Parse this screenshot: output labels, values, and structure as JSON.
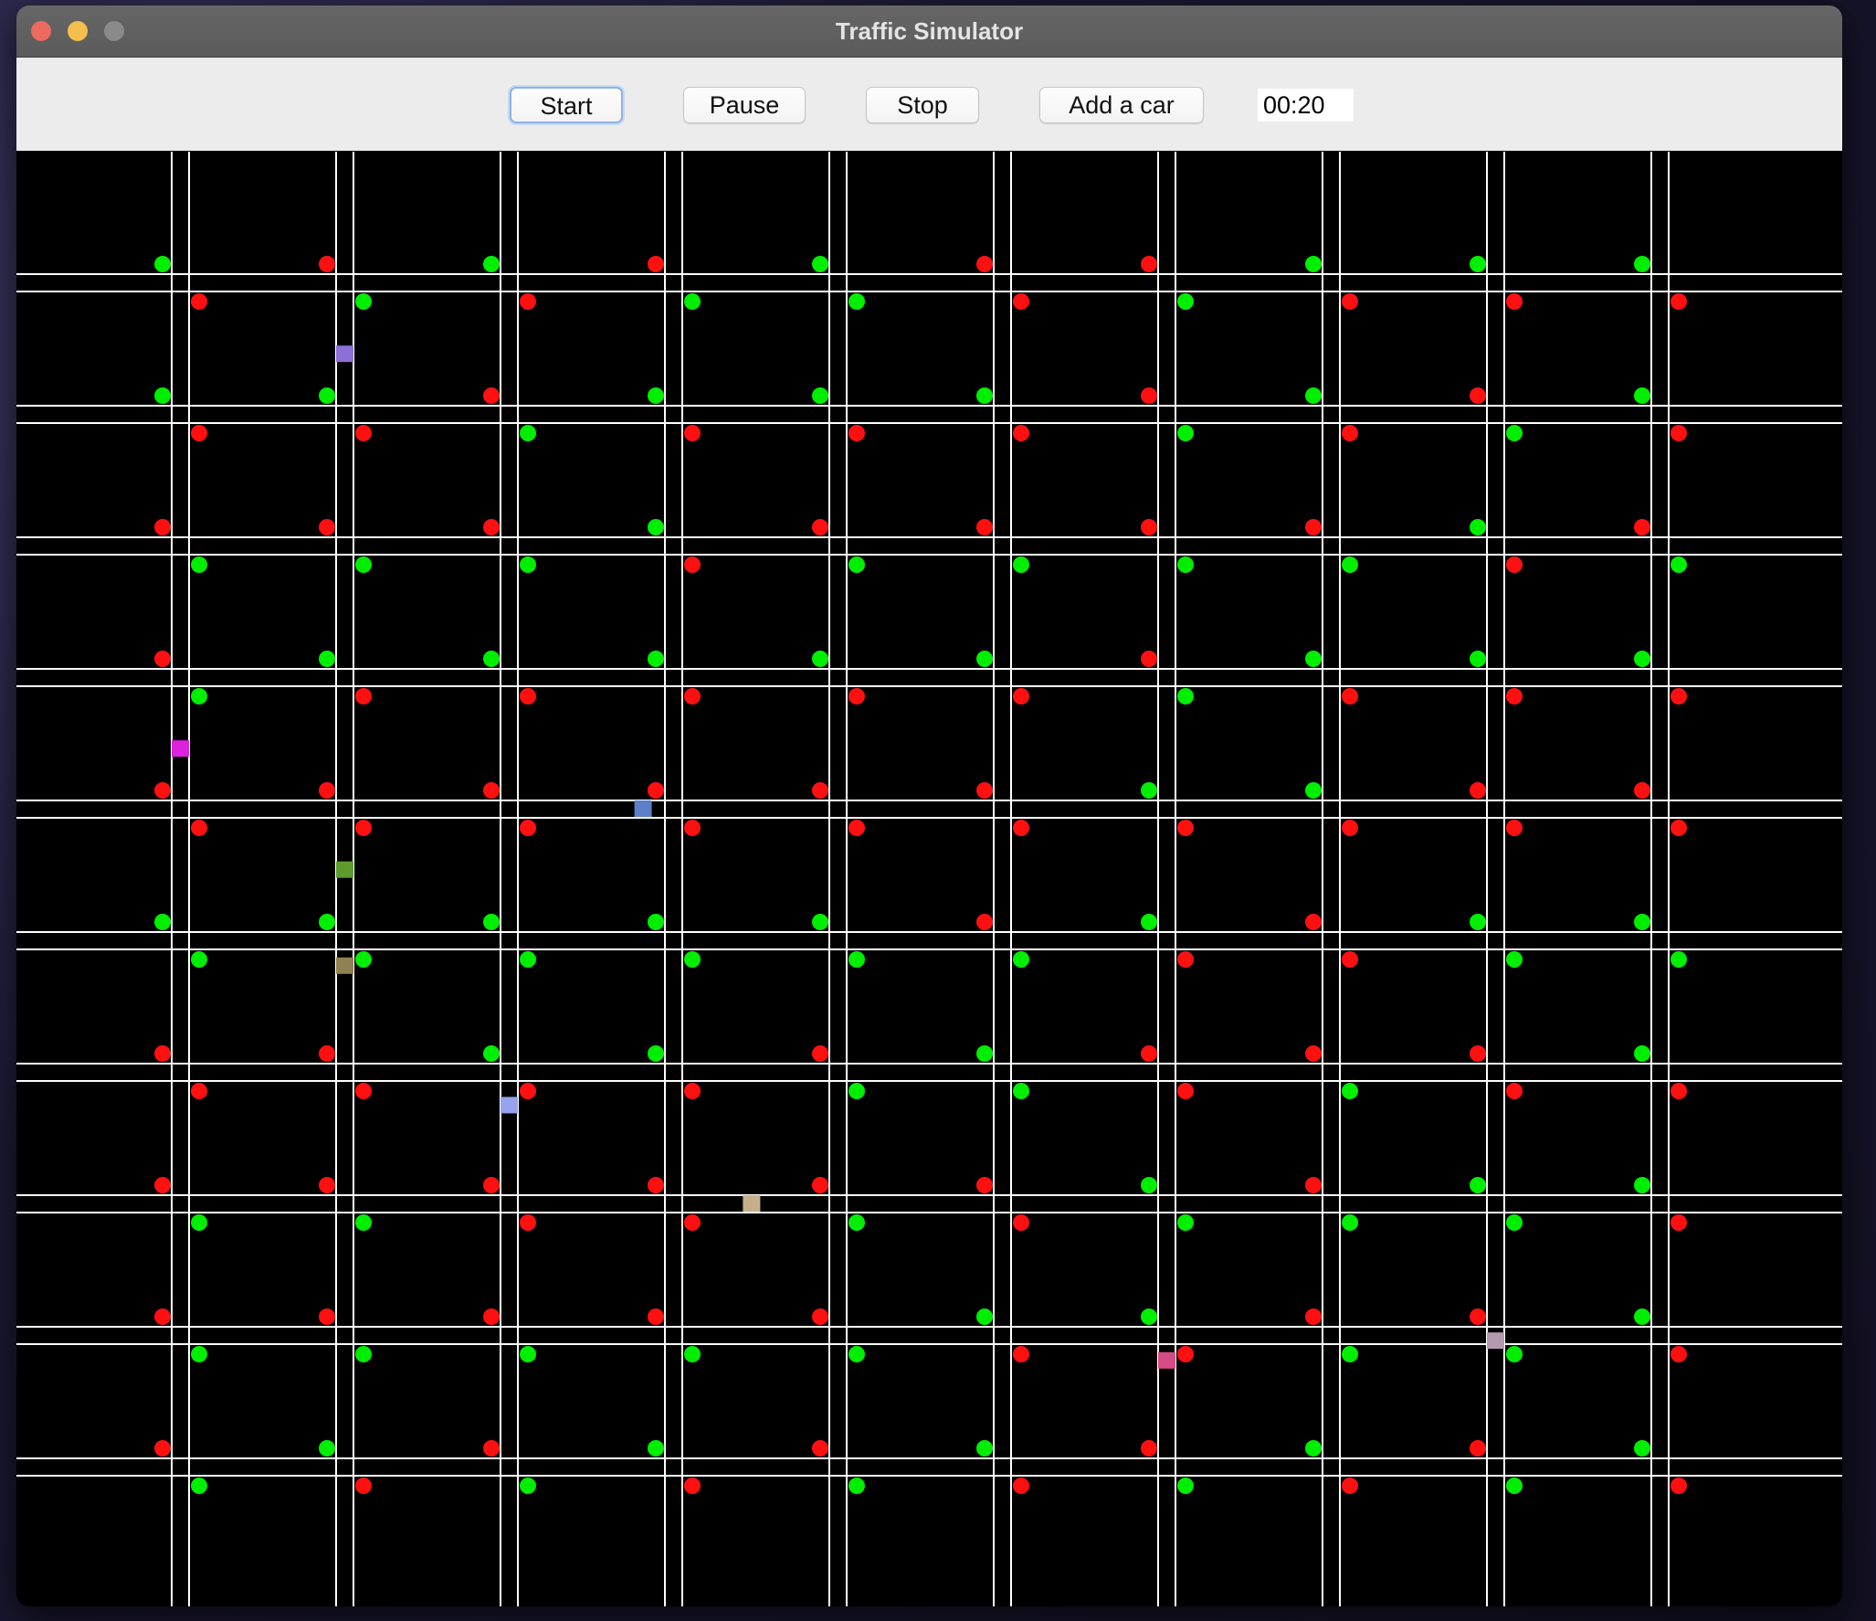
{
  "window": {
    "title": "Traffic Simulator"
  },
  "toolbar": {
    "start_label": "Start",
    "pause_label": "Pause",
    "stop_label": "Stop",
    "add_car_label": "Add a car",
    "timer": "00:20"
  },
  "colors": {
    "road": "#ffffff",
    "light_green": "#00ee00",
    "light_red": "#ff1010",
    "canvas_bg": "#000000"
  },
  "traffic_lights": {
    "grid_size": "10x10",
    "rows": [
      [
        "GR",
        "RG",
        "GR",
        "RG",
        "GG",
        "RR",
        "RG",
        "GR",
        "GR",
        "GR"
      ],
      [
        "GR",
        "GR",
        "RG",
        "GR",
        "GR",
        "GR",
        "RG",
        "GR",
        "RG",
        "GR"
      ],
      [
        "RG",
        "RG",
        "RG",
        "GR",
        "RG",
        "RG",
        "RG",
        "RG",
        "GR",
        "RG"
      ],
      [
        "RG",
        "GR",
        "GR",
        "GR",
        "GR",
        "GR",
        "RG",
        "GR",
        "GR",
        "GR"
      ],
      [
        "RR",
        "RR",
        "RR",
        "RR",
        "RR",
        "RR",
        "GR",
        "GR",
        "RR",
        "RR"
      ],
      [
        "GG",
        "GG",
        "GG",
        "GG",
        "GG",
        "RG",
        "GR",
        "RR",
        "GG",
        "GG"
      ],
      [
        "RR",
        "RR",
        "GR",
        "GR",
        "RG",
        "GG",
        "RR",
        "RG",
        "RR",
        "GR"
      ],
      [
        "RG",
        "RG",
        "RR",
        "RR",
        "RG",
        "RR",
        "GG",
        "RG",
        "GG",
        "GR"
      ],
      [
        "RG",
        "RG",
        "RG",
        "RG",
        "RG",
        "GR",
        "GR",
        "RG",
        "RG",
        "GR"
      ],
      [
        "RG",
        "GR",
        "RG",
        "GR",
        "RG",
        "GR",
        "RG",
        "GR",
        "RG",
        "GR"
      ]
    ]
  },
  "cars": [
    {
      "color": "#8c6fd8",
      "col": 1,
      "row": 0,
      "orient": "v",
      "t": 0.55
    },
    {
      "color": "#dd22dd",
      "col": 0,
      "row": 3,
      "orient": "v",
      "t": 0.55
    },
    {
      "color": "#5b7fc8",
      "col": 2,
      "row": 4,
      "orient": "h",
      "t": 0.82
    },
    {
      "color": "#5f9b2c",
      "col": 1,
      "row": 4,
      "orient": "v",
      "t": 0.47
    },
    {
      "color": "#8f8152",
      "col": 1,
      "row": 5,
      "orient": "v",
      "t": 0.2
    },
    {
      "color": "#96a3ee",
      "col": 2,
      "row": 6,
      "orient": "v",
      "t": 0.26
    },
    {
      "color": "#c5b08a",
      "col": 3,
      "row": 7,
      "orient": "h",
      "t": 0.48
    },
    {
      "color": "#b49aac",
      "col": 8,
      "row": 8,
      "orient": "v",
      "t": 0.05
    },
    {
      "color": "#d84c86",
      "col": 6,
      "row": 8,
      "orient": "v",
      "t": 0.2
    }
  ]
}
